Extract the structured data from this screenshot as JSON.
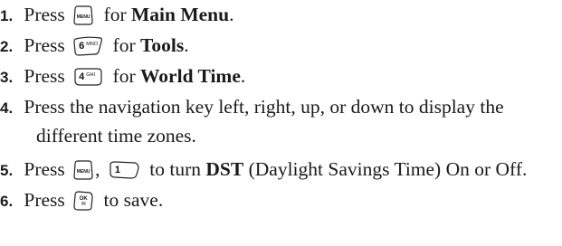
{
  "steps": [
    {
      "num": "1.",
      "pre": "Press",
      "key": {
        "icon": "menu-key-icon",
        "label": "MENU"
      },
      "post": "for",
      "bold": "Main Menu",
      "end": "."
    },
    {
      "num": "2.",
      "pre": "Press",
      "key": {
        "icon": "6-mno-key-icon",
        "digit": "6",
        "letters": "MNO"
      },
      "post": "for",
      "bold": "Tools",
      "end": "."
    },
    {
      "num": "3.",
      "pre": "Press",
      "key": {
        "icon": "4-ghi-key-icon",
        "digit": "4",
        "letters": "GHI"
      },
      "post": "for",
      "bold": "World Time",
      "end": "."
    },
    {
      "num": "4.",
      "line1": "Press the navigation key left, right, up, or down to display the",
      "line2": "different time zones."
    },
    {
      "num": "5.",
      "pre": "Press",
      "key1": {
        "icon": "menu-key-icon",
        "label": "MENU"
      },
      "sep": ",",
      "key2": {
        "icon": "1-key-icon",
        "digit": "1"
      },
      "post": "to turn",
      "bold": "DST",
      "end": "(Daylight Savings Time) On or Off."
    },
    {
      "num": "6.",
      "pre": "Press",
      "key": {
        "icon": "ok-key-icon",
        "label_top": "OK",
        "label_bottom": "✉"
      },
      "post": "to save."
    }
  ]
}
